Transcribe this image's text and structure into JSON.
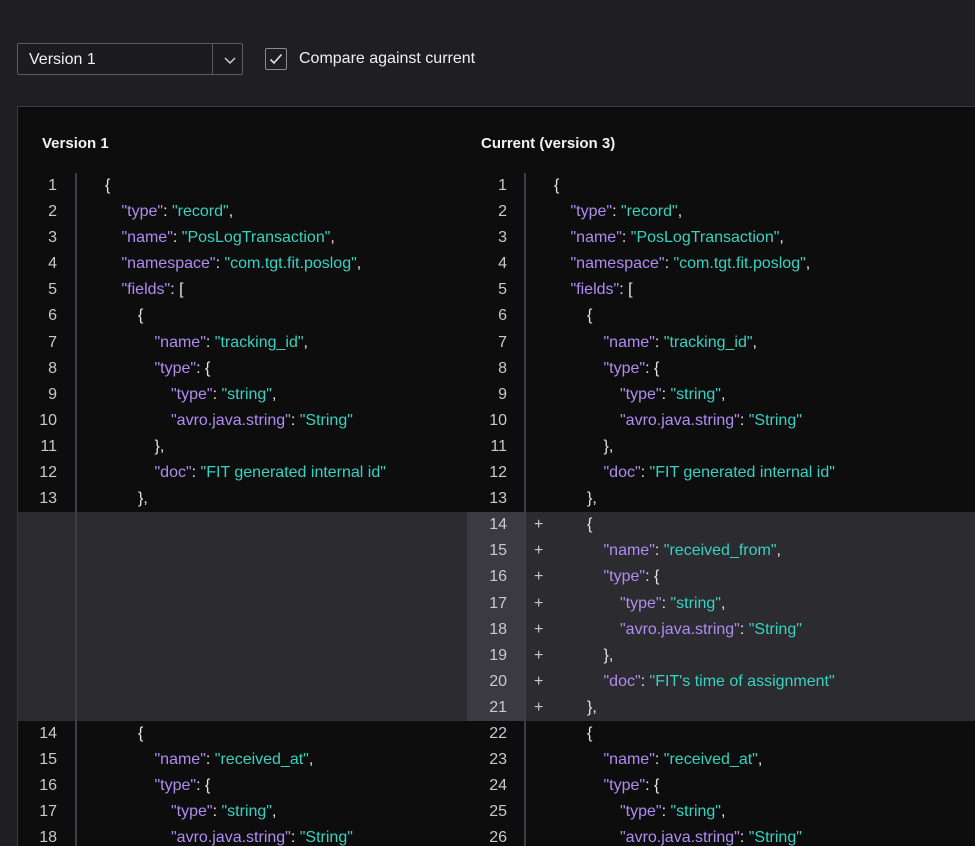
{
  "toolbar": {
    "version_select": {
      "value": "Version 1",
      "icon": "chevron-down-icon"
    },
    "compare_checkbox": {
      "label": "Compare against current",
      "checked": true
    }
  },
  "diff": {
    "left_title": "Version 1",
    "right_title": "Current (version 3)",
    "rows": [
      {
        "ln": "1",
        "lcode": [
          [
            "p",
            "{"
          ]
        ],
        "rn": "1",
        "rcode": [
          [
            "p",
            "{"
          ]
        ],
        "indent": 0
      },
      {
        "ln": "2",
        "lcode": [
          [
            "k",
            "\"type\""
          ],
          [
            "p",
            ": "
          ],
          [
            "s",
            "\"record\""
          ],
          [
            "p",
            ","
          ]
        ],
        "rn": "2",
        "rcode": [
          [
            "k",
            "\"type\""
          ],
          [
            "p",
            ": "
          ],
          [
            "s",
            "\"record\""
          ],
          [
            "p",
            ","
          ]
        ],
        "indent": 1
      },
      {
        "ln": "3",
        "lcode": [
          [
            "k",
            "\"name\""
          ],
          [
            "p",
            ": "
          ],
          [
            "s",
            "\"PosLogTransaction\""
          ],
          [
            "p",
            ","
          ]
        ],
        "rn": "3",
        "rcode": [
          [
            "k",
            "\"name\""
          ],
          [
            "p",
            ": "
          ],
          [
            "s",
            "\"PosLogTransaction\""
          ],
          [
            "p",
            ","
          ]
        ],
        "indent": 1
      },
      {
        "ln": "4",
        "lcode": [
          [
            "k",
            "\"namespace\""
          ],
          [
            "p",
            ": "
          ],
          [
            "s",
            "\"com.tgt.fit.poslog\""
          ],
          [
            "p",
            ","
          ]
        ],
        "rn": "4",
        "rcode": [
          [
            "k",
            "\"namespace\""
          ],
          [
            "p",
            ": "
          ],
          [
            "s",
            "\"com.tgt.fit.poslog\""
          ],
          [
            "p",
            ","
          ]
        ],
        "indent": 1
      },
      {
        "ln": "5",
        "lcode": [
          [
            "k",
            "\"fields\""
          ],
          [
            "p",
            ": ["
          ]
        ],
        "rn": "5",
        "rcode": [
          [
            "k",
            "\"fields\""
          ],
          [
            "p",
            ": ["
          ]
        ],
        "indent": 1
      },
      {
        "ln": "6",
        "lcode": [
          [
            "p",
            "{"
          ]
        ],
        "rn": "6",
        "rcode": [
          [
            "p",
            "{"
          ]
        ],
        "indent": 2
      },
      {
        "ln": "7",
        "lcode": [
          [
            "k",
            "\"name\""
          ],
          [
            "p",
            ": "
          ],
          [
            "s",
            "\"tracking_id\""
          ],
          [
            "p",
            ","
          ]
        ],
        "rn": "7",
        "rcode": [
          [
            "k",
            "\"name\""
          ],
          [
            "p",
            ": "
          ],
          [
            "s",
            "\"tracking_id\""
          ],
          [
            "p",
            ","
          ]
        ],
        "indent": 3
      },
      {
        "ln": "8",
        "lcode": [
          [
            "k",
            "\"type\""
          ],
          [
            "p",
            ": {"
          ]
        ],
        "rn": "8",
        "rcode": [
          [
            "k",
            "\"type\""
          ],
          [
            "p",
            ": {"
          ]
        ],
        "indent": 3
      },
      {
        "ln": "9",
        "lcode": [
          [
            "k",
            "\"type\""
          ],
          [
            "p",
            ": "
          ],
          [
            "s",
            "\"string\""
          ],
          [
            "p",
            ","
          ]
        ],
        "rn": "9",
        "rcode": [
          [
            "k",
            "\"type\""
          ],
          [
            "p",
            ": "
          ],
          [
            "s",
            "\"string\""
          ],
          [
            "p",
            ","
          ]
        ],
        "indent": 4
      },
      {
        "ln": "10",
        "lcode": [
          [
            "k",
            "\"avro.java.string\""
          ],
          [
            "p",
            ": "
          ],
          [
            "s",
            "\"String\""
          ]
        ],
        "rn": "10",
        "rcode": [
          [
            "k",
            "\"avro.java.string\""
          ],
          [
            "p",
            ": "
          ],
          [
            "s",
            "\"String\""
          ]
        ],
        "indent": 4
      },
      {
        "ln": "11",
        "lcode": [
          [
            "p",
            "},"
          ]
        ],
        "rn": "11",
        "rcode": [
          [
            "p",
            "},"
          ]
        ],
        "indent": 3
      },
      {
        "ln": "12",
        "lcode": [
          [
            "k",
            "\"doc\""
          ],
          [
            "p",
            ": "
          ],
          [
            "s",
            "\"FIT generated internal id\""
          ]
        ],
        "rn": "12",
        "rcode": [
          [
            "k",
            "\"doc\""
          ],
          [
            "p",
            ": "
          ],
          [
            "s",
            "\"FIT generated internal id\""
          ]
        ],
        "indent": 3
      },
      {
        "ln": "13",
        "lcode": [
          [
            "p",
            "},"
          ]
        ],
        "rn": "13",
        "rcode": [
          [
            "p",
            "},"
          ]
        ],
        "indent": 2
      },
      {
        "added": true,
        "rn": "14",
        "rcode": [
          [
            "p",
            "{"
          ]
        ],
        "indent": 2
      },
      {
        "added": true,
        "rn": "15",
        "rcode": [
          [
            "k",
            "\"name\""
          ],
          [
            "p",
            ": "
          ],
          [
            "s",
            "\"received_from\""
          ],
          [
            "p",
            ","
          ]
        ],
        "indent": 3
      },
      {
        "added": true,
        "rn": "16",
        "rcode": [
          [
            "k",
            "\"type\""
          ],
          [
            "p",
            ": {"
          ]
        ],
        "indent": 3
      },
      {
        "added": true,
        "rn": "17",
        "rcode": [
          [
            "k",
            "\"type\""
          ],
          [
            "p",
            ": "
          ],
          [
            "s",
            "\"string\""
          ],
          [
            "p",
            ","
          ]
        ],
        "indent": 4
      },
      {
        "added": true,
        "rn": "18",
        "rcode": [
          [
            "k",
            "\"avro.java.string\""
          ],
          [
            "p",
            ": "
          ],
          [
            "s",
            "\"String\""
          ]
        ],
        "indent": 4
      },
      {
        "added": true,
        "rn": "19",
        "rcode": [
          [
            "p",
            "},"
          ]
        ],
        "indent": 3
      },
      {
        "added": true,
        "rn": "20",
        "rcode": [
          [
            "k",
            "\"doc\""
          ],
          [
            "p",
            ": "
          ],
          [
            "s",
            "\"FIT's time of assignment\""
          ]
        ],
        "indent": 3
      },
      {
        "added": true,
        "rn": "21",
        "rcode": [
          [
            "p",
            "},"
          ]
        ],
        "indent": 2
      },
      {
        "ln": "14",
        "lcode": [
          [
            "p",
            "{"
          ]
        ],
        "rn": "22",
        "rcode": [
          [
            "p",
            "{"
          ]
        ],
        "indent": 2
      },
      {
        "ln": "15",
        "lcode": [
          [
            "k",
            "\"name\""
          ],
          [
            "p",
            ": "
          ],
          [
            "s",
            "\"received_at\""
          ],
          [
            "p",
            ","
          ]
        ],
        "rn": "23",
        "rcode": [
          [
            "k",
            "\"name\""
          ],
          [
            "p",
            ": "
          ],
          [
            "s",
            "\"received_at\""
          ],
          [
            "p",
            ","
          ]
        ],
        "indent": 3
      },
      {
        "ln": "16",
        "lcode": [
          [
            "k",
            "\"type\""
          ],
          [
            "p",
            ": {"
          ]
        ],
        "rn": "24",
        "rcode": [
          [
            "k",
            "\"type\""
          ],
          [
            "p",
            ": {"
          ]
        ],
        "indent": 3
      },
      {
        "ln": "17",
        "lcode": [
          [
            "k",
            "\"type\""
          ],
          [
            "p",
            ": "
          ],
          [
            "s",
            "\"string\""
          ],
          [
            "p",
            ","
          ]
        ],
        "rn": "25",
        "rcode": [
          [
            "k",
            "\"type\""
          ],
          [
            "p",
            ": "
          ],
          [
            "s",
            "\"string\""
          ],
          [
            "p",
            ","
          ]
        ],
        "indent": 4
      },
      {
        "ln": "18",
        "lcode": [
          [
            "k",
            "\"avro.java.string\""
          ],
          [
            "p",
            ": "
          ],
          [
            "s",
            "\"String\""
          ]
        ],
        "rn": "26",
        "rcode": [
          [
            "k",
            "\"avro.java.string\""
          ],
          [
            "p",
            ": "
          ],
          [
            "s",
            "\"String\""
          ]
        ],
        "indent": 4
      }
    ],
    "added_marker": "+"
  },
  "colors": {
    "key": "#b08cf0",
    "string": "#36d3c0",
    "added_background": "#2b2b30"
  }
}
